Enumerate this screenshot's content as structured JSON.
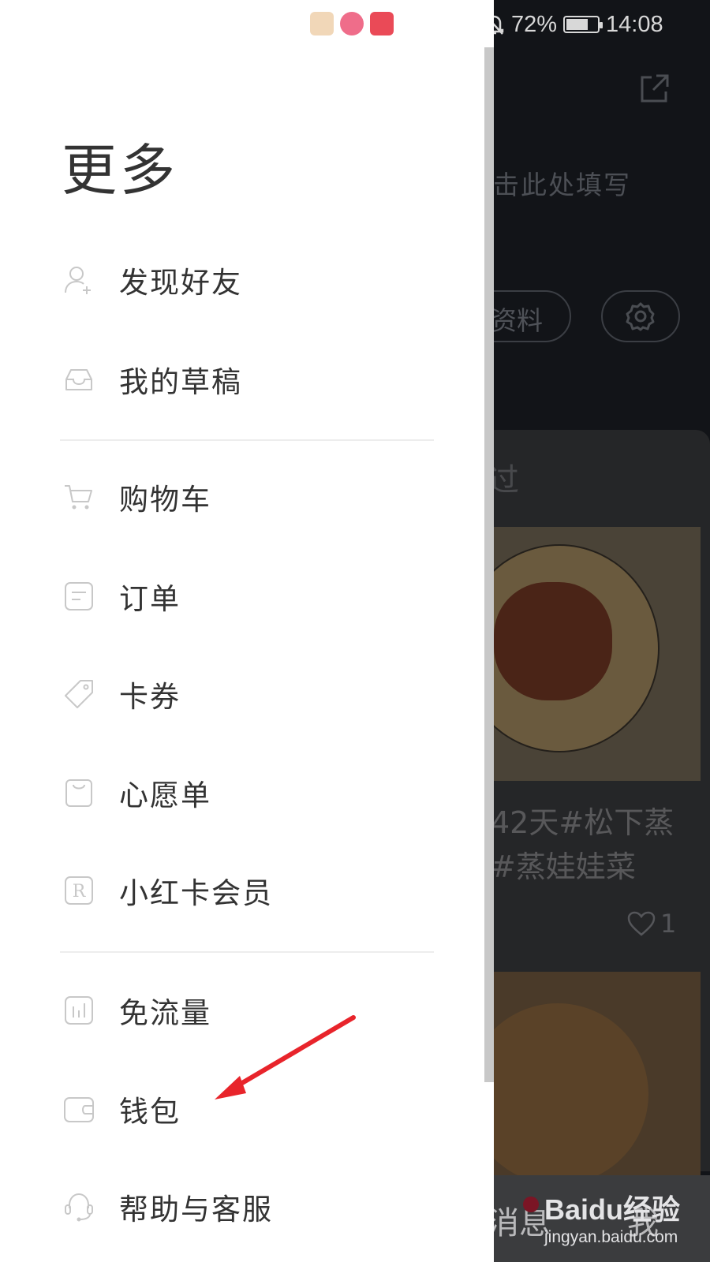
{
  "status_bar": {
    "battery_text": "72%",
    "battery_level": 0.72,
    "time": "14:08"
  },
  "drawer": {
    "title": "更多",
    "groups": [
      {
        "items": [
          {
            "label": "发现好友",
            "icon": "add-friend-icon"
          },
          {
            "label": "我的草稿",
            "icon": "drafts-inbox-icon"
          }
        ]
      },
      {
        "items": [
          {
            "label": "购物车",
            "icon": "shopping-cart-icon"
          },
          {
            "label": "订单",
            "icon": "order-icon"
          },
          {
            "label": "卡券",
            "icon": "coupon-tag-icon"
          },
          {
            "label": "心愿单",
            "icon": "wishlist-bag-icon"
          },
          {
            "label": "小红卡会员",
            "icon": "member-card-icon"
          }
        ]
      },
      {
        "items": [
          {
            "label": "免流量",
            "icon": "free-data-icon"
          },
          {
            "label": "钱包",
            "icon": "wallet-icon"
          },
          {
            "label": "帮助与客服",
            "icon": "headset-icon"
          }
        ]
      }
    ]
  },
  "background": {
    "fill_hint": "点击此处填写",
    "edit_profile": "资料",
    "tab": "过",
    "card_title": "42天#松下蒸\n#蒸娃娃菜",
    "like_count": "1",
    "nav_messages": "消息",
    "nav_me": "我"
  },
  "watermark": {
    "logo": "Baidu经验",
    "url": "jingyan.baidu.com"
  },
  "colors": {
    "arrow": "#e8242b",
    "drawer_bg": "#ffffff",
    "backdrop": "#121418"
  }
}
